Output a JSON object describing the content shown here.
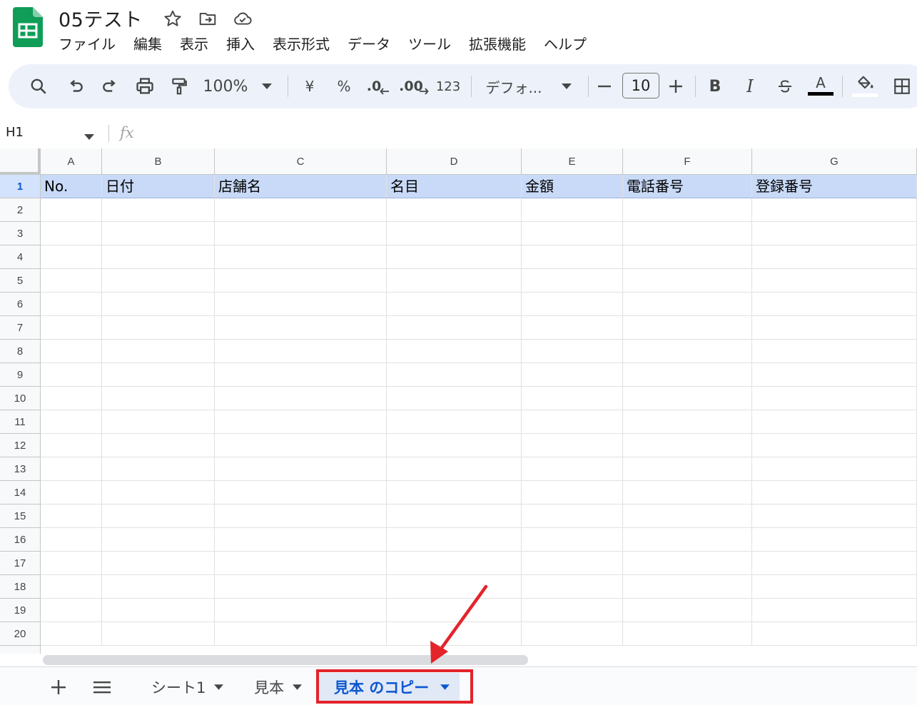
{
  "app": {
    "title": "05テスト"
  },
  "menu": [
    "ファイル",
    "編集",
    "表示",
    "挿入",
    "表示形式",
    "データ",
    "ツール",
    "拡張機能",
    "ヘルプ"
  ],
  "toolbar": {
    "zoom": "100%",
    "currency": "¥",
    "percent": "%",
    "decrease_decimal": ".0",
    "increase_decimal": ".00",
    "number_format": "123",
    "font": "デフォ...",
    "font_size": "10",
    "bold": "B",
    "italic": "I",
    "text_color": "A",
    "text_color_swatch": "#000000"
  },
  "formula_bar": {
    "cell_ref": "H1",
    "fx": "fx"
  },
  "grid": {
    "columns": [
      "A",
      "B",
      "C",
      "D",
      "E",
      "F",
      "G"
    ],
    "rows": [
      "1",
      "2",
      "3",
      "4",
      "5",
      "6",
      "7",
      "8",
      "9",
      "10",
      "11",
      "12",
      "13",
      "14",
      "15",
      "16",
      "17",
      "18",
      "19",
      "20"
    ],
    "selected_row": "1",
    "header_row": [
      "No.",
      "日付",
      "店舗名",
      "名目",
      "金額",
      "電話番号",
      "登録番号"
    ],
    "header_fill": "#c9daf8"
  },
  "sheets": {
    "tabs": [
      "シート1",
      "見本",
      "見本 のコピー"
    ],
    "active": "見本 のコピー"
  },
  "annotation": {
    "color": "#e3242b"
  }
}
